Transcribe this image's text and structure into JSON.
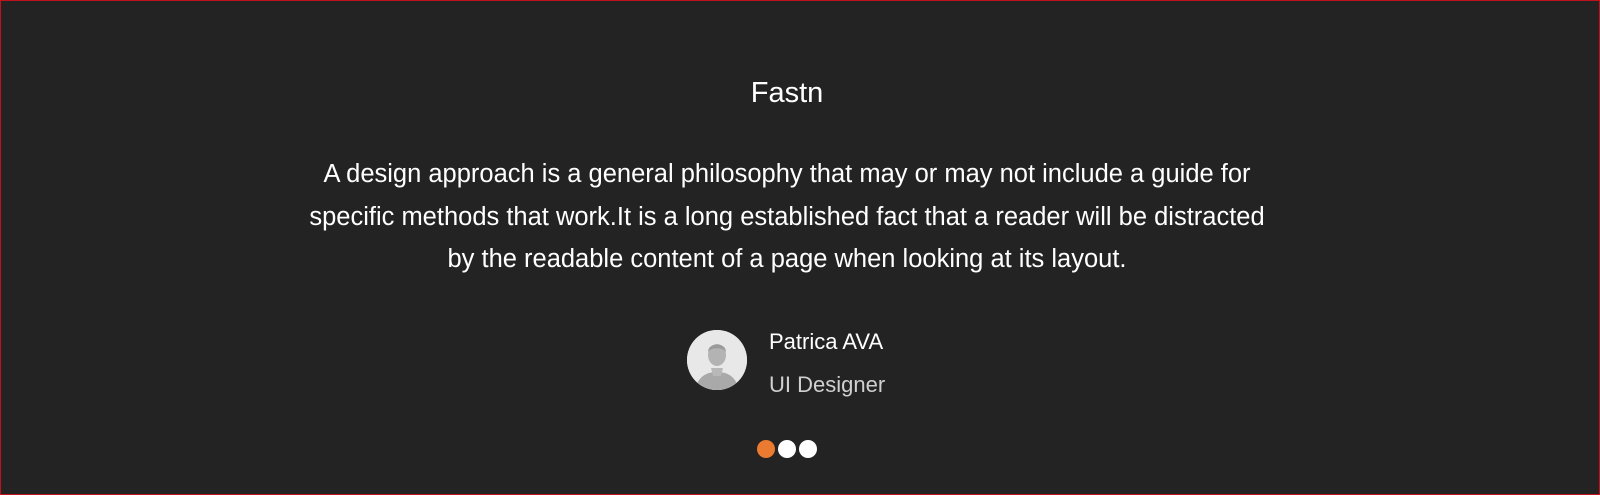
{
  "brand": {
    "name": "Fastn"
  },
  "testimonial": {
    "quote_lines": [
      "A design approach is a general philosophy that may or may not include a guide for",
      "specific methods that work.It is a long established fact that a reader will be distracted",
      "by the readable content of a page when looking at its layout."
    ],
    "author": {
      "name": "Patrica AVA",
      "role": "UI Designer",
      "avatar_icon": "user-silhouette-icon"
    }
  },
  "pagination": {
    "count": 3,
    "active_index": 0
  },
  "colors": {
    "background": "#232323",
    "border": "#c0111f",
    "text": "#ffffff",
    "muted_text": "#d0d0d0",
    "accent": "#ea7b30",
    "dot_inactive": "#ffffff"
  }
}
